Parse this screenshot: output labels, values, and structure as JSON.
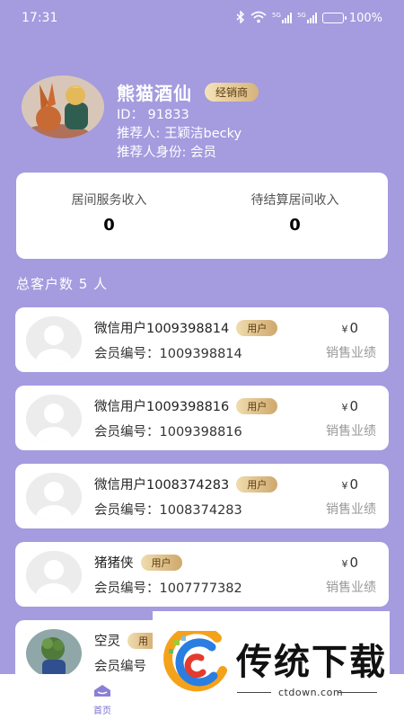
{
  "status_bar": {
    "time": "17:31",
    "net1": "5G",
    "net2": "5G",
    "battery": "100%"
  },
  "profile": {
    "name": "熊猫酒仙",
    "badge": "经销商",
    "id_line": "ID： 91833",
    "referrer_line": "推荐人: 王颖洁becky",
    "referrer_identity_line": "推荐人身份: 会员"
  },
  "income": {
    "room_service_label": "居间服务收入",
    "room_service_value": "0",
    "pending_label": "待结算居间收入",
    "pending_value": "0"
  },
  "total_customers": "总客户数 5 人",
  "customers": [
    {
      "name": "微信用户1009398814",
      "badge": "用户",
      "member_id": "会员编号：1009398814",
      "currency": "¥",
      "amount": "0",
      "perf_label": "销售业绩"
    },
    {
      "name": "微信用户1009398816",
      "badge": "用户",
      "member_id": "会员编号：1009398816",
      "currency": "¥",
      "amount": "0",
      "perf_label": "销售业绩"
    },
    {
      "name": "微信用户1008374283",
      "badge": "用户",
      "member_id": "会员编号：1008374283",
      "currency": "¥",
      "amount": "0",
      "perf_label": "销售业绩"
    },
    {
      "name": "猪猪侠",
      "badge": "用户",
      "member_id": "会员编号：1007777382",
      "currency": "¥",
      "amount": "0",
      "perf_label": "销售业绩"
    },
    {
      "name": "空灵",
      "badge": "用",
      "member_id": "会员编号",
      "currency": "",
      "amount": "",
      "perf_label": ""
    }
  ],
  "tabbar": {
    "home_label": "首页"
  },
  "watermark": {
    "text": "传统下载",
    "url": "ctdown.com"
  }
}
